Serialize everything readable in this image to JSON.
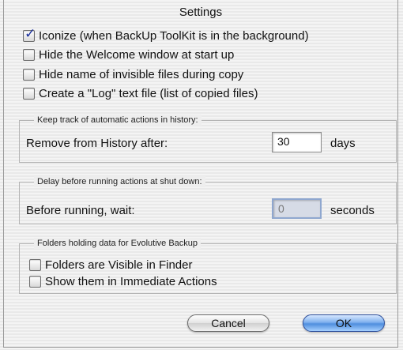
{
  "window": {
    "title": "Settings"
  },
  "options": [
    {
      "label": "Iconize (when BackUp ToolKit is in the background)",
      "checked": true
    },
    {
      "label": "Hide the Welcome window at start up",
      "checked": false
    },
    {
      "label": "Hide name of invisible files during copy",
      "checked": false
    },
    {
      "label": "Create a \"Log\" text file (list of copied files)",
      "checked": false
    }
  ],
  "history": {
    "group_label": "Keep track of automatic actions in history:",
    "row_label": "Remove from History after:",
    "value": "30",
    "unit": "days"
  },
  "shutdown": {
    "group_label": "Delay before running actions at shut down:",
    "row_label": "Before running, wait:",
    "value": "0",
    "unit": "seconds"
  },
  "folders": {
    "group_label": "Folders holding data for Evolutive Backup",
    "options": [
      {
        "label": "Folders are Visible in Finder",
        "checked": false
      },
      {
        "label": "Show them in Immediate Actions",
        "checked": false
      }
    ]
  },
  "buttons": {
    "cancel": "Cancel",
    "ok": "OK"
  },
  "colors": {
    "default_button": "#5b97e2",
    "checkmark": "#1a2f9c"
  }
}
